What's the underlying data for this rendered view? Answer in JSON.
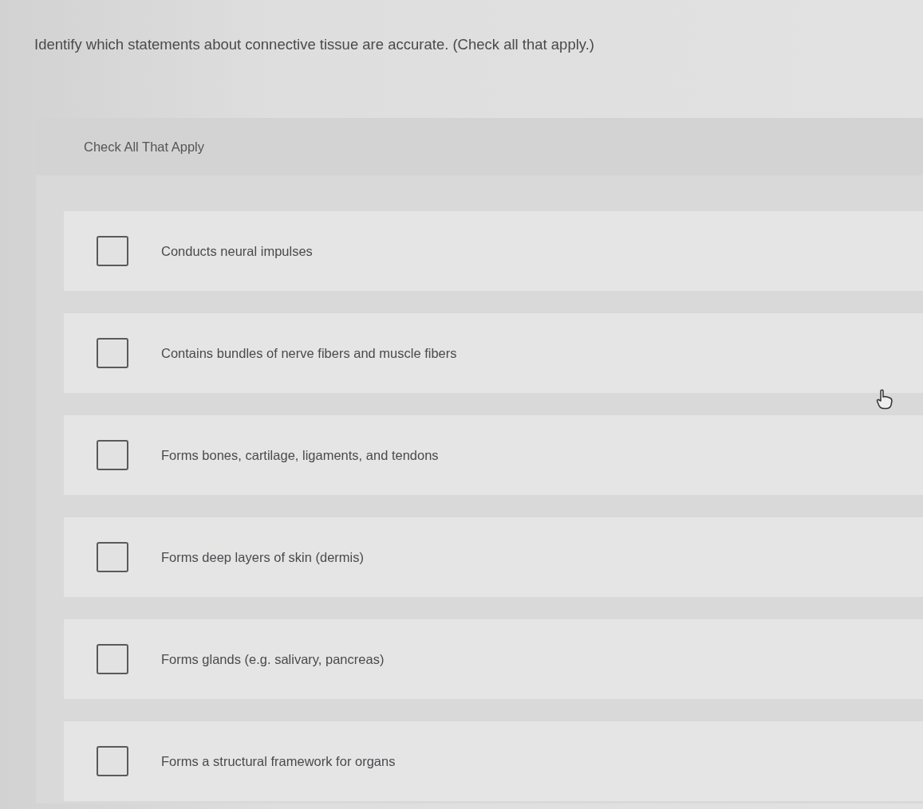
{
  "question": {
    "text": "Identify which statements about connective tissue are accurate. (Check all that apply.)"
  },
  "panel": {
    "heading": "Check All That Apply",
    "options": [
      {
        "label": "Conducts neural impulses",
        "checked": false
      },
      {
        "label": "Contains bundles of nerve fibers and muscle fibers",
        "checked": false
      },
      {
        "label": "Forms bones, cartilage, ligaments, and tendons",
        "checked": false
      },
      {
        "label": "Forms deep layers of skin (dermis)",
        "checked": false
      },
      {
        "label": "Forms glands (e.g. salivary, pancreas)",
        "checked": false
      },
      {
        "label": "Forms a structural framework for organs",
        "checked": false
      }
    ]
  }
}
